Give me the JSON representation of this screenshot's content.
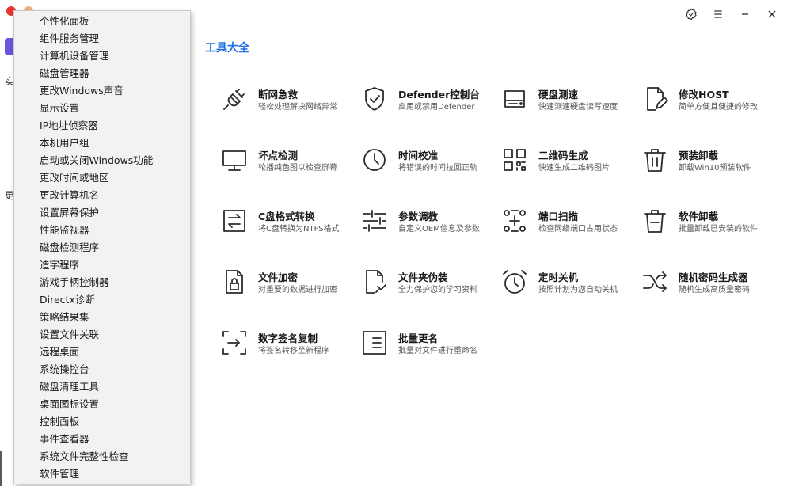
{
  "window": {
    "accent": "#1f6fe5"
  },
  "left_fragments": {
    "a": "实",
    "b": "更"
  },
  "context_menu": {
    "items": [
      "个性化面板",
      "组件服务管理",
      "计算机设备管理",
      "磁盘管理器",
      "更改Windows声音",
      "显示设置",
      "IP地址侦察器",
      "本机用户组",
      "启动或关闭Windows功能",
      "更改时间或地区",
      "更改计算机名",
      "设置屏幕保护",
      "性能监视器",
      "磁盘检测程序",
      "造字程序",
      "游戏手柄控制器",
      "Directx诊断",
      "策略结果集",
      "设置文件关联",
      "远程桌面",
      "系统操控台",
      "磁盘清理工具",
      "桌面图标设置",
      "控制面板",
      "事件查看器",
      "系统文件完整性检查",
      "软件管理"
    ]
  },
  "main": {
    "section_title": "工具大全",
    "tools": [
      {
        "name": "断网急救",
        "desc": "轻松处理解决网络异常",
        "icon": "plug-icon"
      },
      {
        "name": "Defender控制台",
        "desc": "启用或禁用Defender",
        "icon": "shield-check-icon"
      },
      {
        "name": "硬盘测速",
        "desc": "快速测速硬盘读写速度",
        "icon": "hard-drive-icon"
      },
      {
        "name": "修改HOST",
        "desc": "简单方便且便捷的修改",
        "icon": "file-edit-icon"
      },
      {
        "name": "坏点检测",
        "desc": "轮播纯色图以检查屏幕",
        "icon": "monitor-icon"
      },
      {
        "name": "时间校准",
        "desc": "将错误的时间拉回正轨",
        "icon": "clock-icon"
      },
      {
        "name": "二维码生成",
        "desc": "快速生成二维码图片",
        "icon": "qrcode-icon"
      },
      {
        "name": "预装卸载",
        "desc": "卸载Win10预装软件",
        "icon": "trash-icon"
      },
      {
        "name": "C盘格式转换",
        "desc": "将C盘转换为NTFS格式",
        "icon": "swap-icon"
      },
      {
        "name": "参数调教",
        "desc": "自定义OEM信息及参数",
        "icon": "sliders-icon"
      },
      {
        "name": "端口扫描",
        "desc": "检查网络端口占用状态",
        "icon": "network-scan-icon"
      },
      {
        "name": "软件卸载",
        "desc": "批量卸载已安装的软件",
        "icon": "trash-lines-icon"
      },
      {
        "name": "文件加密",
        "desc": "对重要的数据进行加密",
        "icon": "file-lock-icon"
      },
      {
        "name": "文件夹伪装",
        "desc": "全力保护您的学习资料",
        "icon": "file-disguise-icon"
      },
      {
        "name": "定时关机",
        "desc": "按照计划为您自动关机",
        "icon": "alarm-clock-icon"
      },
      {
        "name": "随机密码生成器",
        "desc": "随机生成高质量密码",
        "icon": "shuffle-icon"
      },
      {
        "name": "数字签名复制",
        "desc": "将签名转移至新程序",
        "icon": "signature-copy-icon"
      },
      {
        "name": "批量更名",
        "desc": "批量对文件进行重命名",
        "icon": "rename-icon"
      }
    ]
  },
  "controls": {
    "verify_icon": "badge-check-icon",
    "menu_icon": "hamburger-icon",
    "minimize_icon": "minimize-icon",
    "close_icon": "close-icon"
  }
}
